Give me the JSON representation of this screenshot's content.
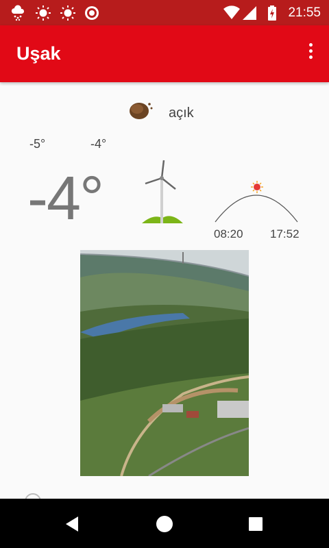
{
  "status_bar": {
    "time": "21:55",
    "left_icons": [
      "cloud-snow-icon",
      "sun-icon",
      "sun-icon",
      "target-icon"
    ],
    "right_icons": [
      "wifi-icon",
      "signal-icon",
      "battery-charging-icon"
    ]
  },
  "app_bar": {
    "title": "Uşak"
  },
  "weather": {
    "condition": "açık",
    "temp_low": "-5°",
    "temp_high": "-4°",
    "current_temp": "-4°",
    "sunrise": "08:20",
    "sunset": "17:52"
  },
  "colors": {
    "status_bar": "#b71c1c",
    "app_bar": "#e10916",
    "sun": "#e53935"
  }
}
